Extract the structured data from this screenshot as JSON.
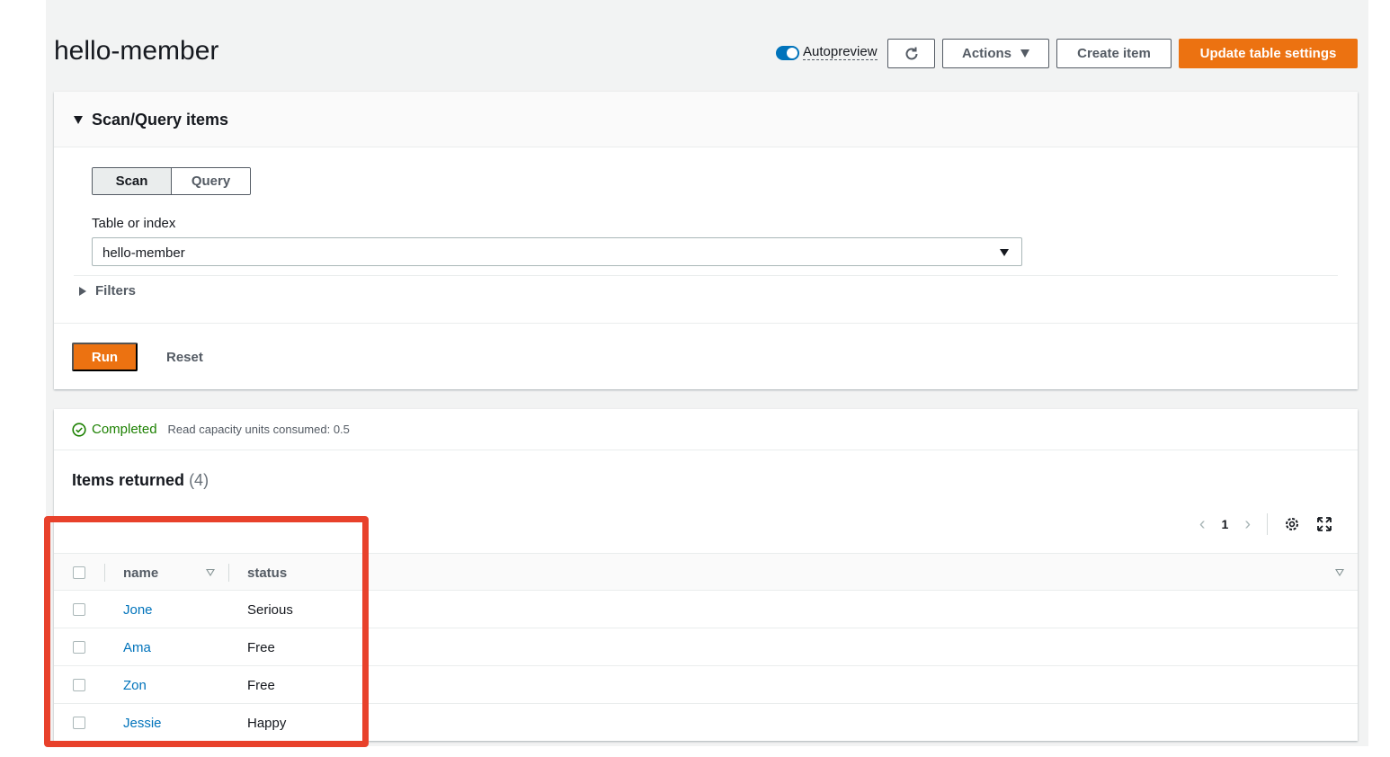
{
  "header": {
    "title": "hello-member",
    "autopreview_label": "Autopreview",
    "actions_label": "Actions",
    "create_item_label": "Create item",
    "update_settings_label": "Update table settings"
  },
  "scan_panel": {
    "title": "Scan/Query items",
    "mode_scan": "Scan",
    "mode_query": "Query",
    "selected_mode": "Scan",
    "table_label": "Table or index",
    "table_value": "hello-member",
    "filters_label": "Filters",
    "run_label": "Run",
    "reset_label": "Reset"
  },
  "results": {
    "status": "Completed",
    "status_detail": "Read capacity units consumed: 0.5",
    "items_title": "Items returned",
    "items_count": "(4)",
    "page": "1",
    "columns": [
      "name",
      "status"
    ],
    "rows": [
      {
        "name": "Jone",
        "status": "Serious"
      },
      {
        "name": "Ama",
        "status": "Free"
      },
      {
        "name": "Zon",
        "status": "Free"
      },
      {
        "name": "Jessie",
        "status": "Happy"
      }
    ]
  },
  "colors": {
    "primary_orange": "#ec7211",
    "link_blue": "#0073bb",
    "success_green": "#1d8102",
    "highlight_red": "#e8412b"
  },
  "icons": {
    "refresh": "refresh-icon",
    "settings": "gear-icon",
    "fullscreen": "fullscreen-icon",
    "success": "check-circle-icon"
  }
}
